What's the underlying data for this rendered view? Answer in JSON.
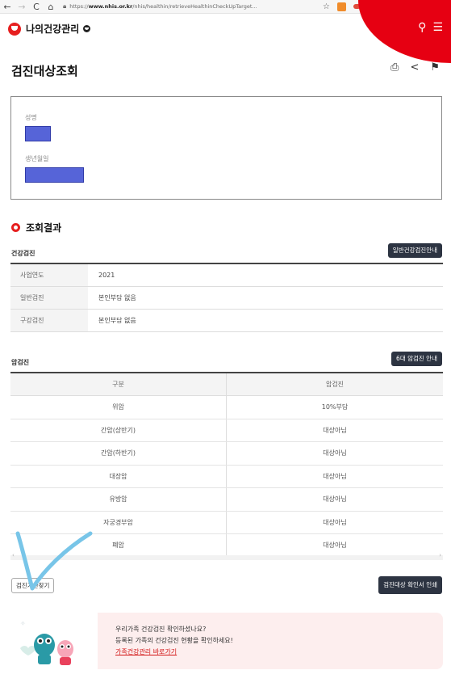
{
  "browser": {
    "back": "←",
    "forward": "→",
    "reload": "C",
    "home": "⌂",
    "url_prefix": "https://",
    "url_domain": "www.nhis.or.kr",
    "url_path": "/nhis/healthin/retrieveHealthinCheckUpTarget...",
    "star": "☆",
    "more": "···"
  },
  "site": {
    "logo_text": "나의건강관리",
    "search_icon": "⚲",
    "menu_icon": "☰",
    "brand_color": "#e60012"
  },
  "page": {
    "title": "검진대상조회",
    "print_icon": "⎙",
    "share_icon": "<",
    "bookmark_icon": "⚑"
  },
  "user_info": {
    "name_label": "성명",
    "birth_label": "생년월일"
  },
  "results": {
    "title": "조회결과",
    "general": {
      "label": "건강검진",
      "guide_button": "일반건강검진안내",
      "rows": [
        {
          "key": "사업연도",
          "value": "2021"
        },
        {
          "key": "일반검진",
          "value": "본인부담 없음"
        },
        {
          "key": "구강검진",
          "value": "본인부담 없음"
        }
      ]
    },
    "cancer": {
      "label": "암검진",
      "guide_button": "6대 암검진 안내",
      "headers": [
        "구분",
        "암검진"
      ],
      "rows": [
        {
          "type": "위암",
          "status": "10%부담"
        },
        {
          "type": "간암(상반기)",
          "status": "대상아님"
        },
        {
          "type": "간암(하반기)",
          "status": "대상아님"
        },
        {
          "type": "대장암",
          "status": "대상아님"
        },
        {
          "type": "유방암",
          "status": "대상아님"
        },
        {
          "type": "자궁경부암",
          "status": "대상아님"
        },
        {
          "type": "폐암",
          "status": "대상아님"
        }
      ]
    },
    "find_center_button": "검진기관찾기",
    "confirm_print_button": "검진대상 확인서 인쇄"
  },
  "banner": {
    "line1": "우리가족 건강검진 확인하셨나요?",
    "line2": "등록된 가족의 건강검진 현황을 확인하세요!",
    "link": "가족건강관리 바로가기"
  }
}
